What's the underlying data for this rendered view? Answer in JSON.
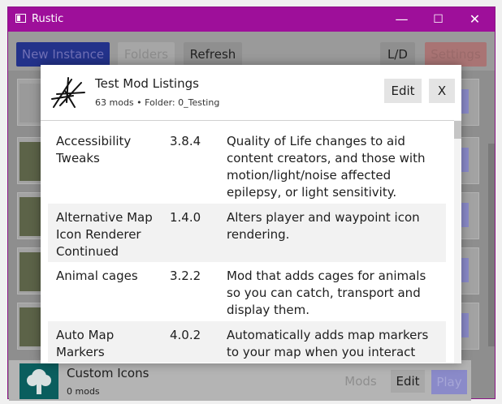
{
  "window": {
    "title": "Rustic",
    "minimize": "—",
    "maximize": "☐",
    "close": "✕"
  },
  "toolbar": {
    "new_instance": "New Instance",
    "folders": "Folders",
    "refresh": "Refresh",
    "theme_toggle": "L/D",
    "settings": "Settings"
  },
  "bottom_instance": {
    "name": "Custom Icons",
    "count": "0 mods",
    "mods_label": "Mods",
    "edit_label": "Edit",
    "play_label": "Play"
  },
  "dialog": {
    "title": "Test Mod Listings",
    "subtitle": "63 mods • Folder: 0_Testing",
    "edit_label": "Edit",
    "close_label": "X",
    "mods": [
      {
        "name": "Accessibility Tweaks",
        "version": "3.8.4",
        "description": "Quality of Life changes to aid content creators, and those with motion/light/noise affected epilepsy, or light sensitivity."
      },
      {
        "name": "Alternative Map Icon Renderer Continued",
        "version": "1.4.0",
        "description": "Alters player and waypoint icon rendering."
      },
      {
        "name": "Animal cages",
        "version": "3.2.2",
        "description": "Mod that adds cages for animals so you can catch, transport and display them."
      },
      {
        "name": "Auto Map Markers",
        "version": "4.0.2",
        "description": "Automatically adds map markers to your map when you interact with"
      }
    ]
  },
  "colors": {
    "titlebar": "#9e0f9a",
    "accent_button": "#1e3fa6",
    "settings_button": "#b88080",
    "row_alt": "#f2f2f2"
  }
}
